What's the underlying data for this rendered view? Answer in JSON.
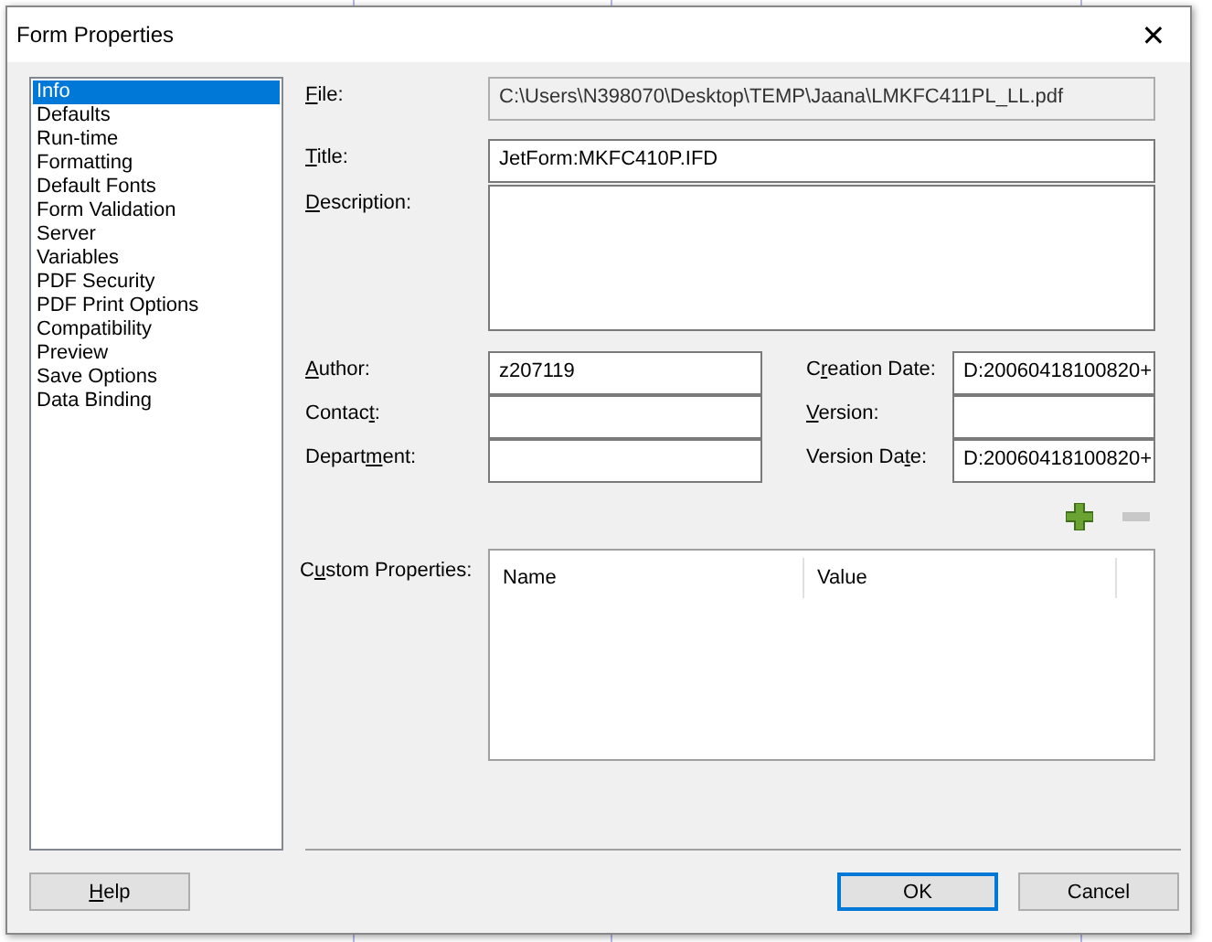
{
  "window": {
    "title": "Form Properties",
    "close": "✕"
  },
  "sidebar": {
    "items": [
      {
        "label": "Info",
        "selected": true
      },
      {
        "label": "Defaults",
        "selected": false
      },
      {
        "label": "Run-time",
        "selected": false
      },
      {
        "label": "Formatting",
        "selected": false
      },
      {
        "label": "Default Fonts",
        "selected": false
      },
      {
        "label": "Form Validation",
        "selected": false
      },
      {
        "label": "Server",
        "selected": false
      },
      {
        "label": "Variables",
        "selected": false
      },
      {
        "label": "PDF Security",
        "selected": false
      },
      {
        "label": "PDF Print Options",
        "selected": false
      },
      {
        "label": "Compatibility",
        "selected": false
      },
      {
        "label": "Preview",
        "selected": false
      },
      {
        "label": "Save Options",
        "selected": false
      },
      {
        "label": "Data Binding",
        "selected": false
      }
    ]
  },
  "file": {
    "label": {
      "key": "F",
      "after": "ile:"
    },
    "value": "C:\\Users\\N398070\\Desktop\\TEMP\\Jaana\\LMKFC411PL_LL.pdf",
    "disabled": true
  },
  "title_field": {
    "label": {
      "key": "T",
      "after": "itle:"
    },
    "value": "JetForm:MKFC410P.IFD"
  },
  "description": {
    "label": {
      "key": "D",
      "after": "escription:"
    }
  },
  "left_fields": [
    {
      "label": {
        "key": "A",
        "after": "uthor:"
      },
      "value": "z207119"
    },
    {
      "label": {
        "before": "Contac",
        "key": "t",
        "after": ":"
      }
    },
    {
      "label": {
        "before": "Depart",
        "key": "m",
        "after": "ent:"
      }
    }
  ],
  "right_fields": [
    {
      "label": {
        "before": "C",
        "key": "r",
        "after": "eation Date:"
      },
      "value": "D:20060418100820+"
    },
    {
      "label": {
        "key": "V",
        "after": "ersion:"
      }
    },
    {
      "label": {
        "before": "Version Da",
        "key": "t",
        "after": "e:"
      },
      "value": "D:20060418100820+"
    }
  ],
  "custom_properties": {
    "label": {
      "before": "C",
      "key": "u",
      "after": "stom Properties:"
    },
    "columns": [
      "Name",
      "Value"
    ]
  },
  "buttons": [
    {
      "label": {
        "key": "H",
        "after": "elp"
      },
      "default": false
    },
    {
      "label": {
        "before": "OK"
      },
      "default": true
    },
    {
      "label": {
        "before": "Cancel"
      },
      "default": false
    }
  ]
}
